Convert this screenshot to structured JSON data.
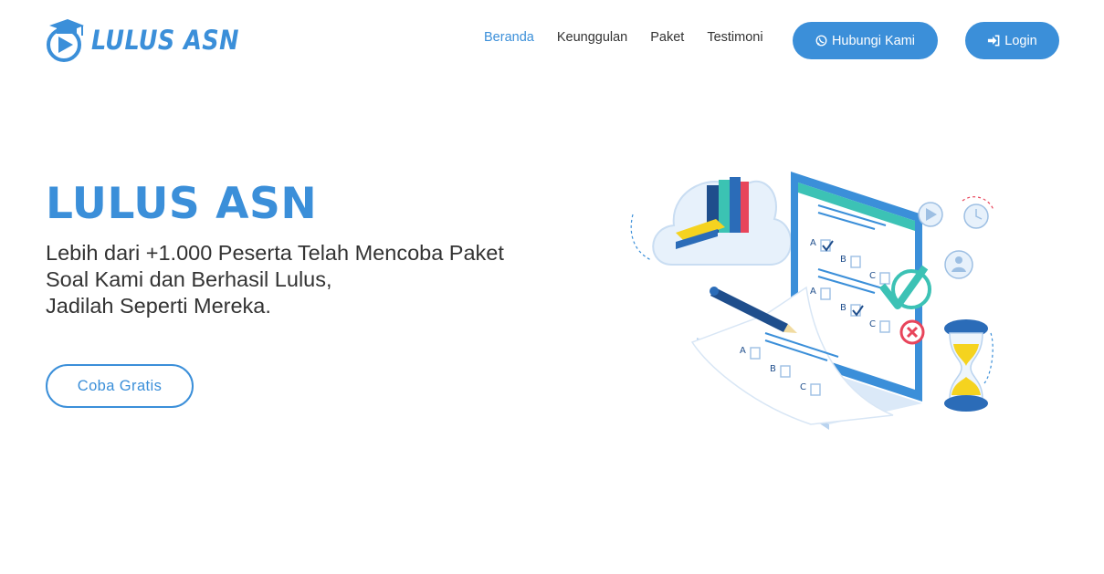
{
  "brand": {
    "name": "LULUS ASN",
    "logo_icon": "graduation-cap-play-icon",
    "color": "#3b8fd9"
  },
  "nav": {
    "links": [
      {
        "label": "Beranda",
        "active": true
      },
      {
        "label": "Keunggulan",
        "active": false
      },
      {
        "label": "Paket",
        "active": false
      },
      {
        "label": "Testimoni",
        "active": false
      }
    ],
    "contact_button": {
      "label": "Hubungi Kami",
      "icon": "whatsapp-icon"
    },
    "login_button": {
      "label": "Login",
      "icon": "sign-in-icon"
    }
  },
  "hero": {
    "title": "LULUS ASN",
    "subtitle_lines": [
      "Lebih dari +1.000 Peserta Telah Mencoba Paket",
      "Soal Kami dan Berhasil Lulus,",
      "Jadilah Seperti Mereka."
    ],
    "cta_label": "Coba Gratis",
    "illustration": {
      "icon": "online-exam-illustration",
      "answer_options": [
        "A",
        "B",
        "C",
        "A",
        "B",
        "C",
        "A",
        "B",
        "C"
      ]
    }
  },
  "colors": {
    "accent": "#3b8fd9",
    "text": "#333333",
    "background": "#ffffff",
    "highlight": "#f5d31f",
    "check": "#3cc2b5",
    "cross": "#e8455b"
  }
}
